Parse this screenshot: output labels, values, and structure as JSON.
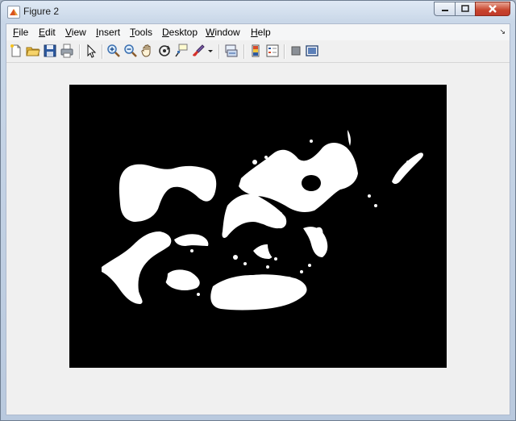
{
  "window": {
    "title": "Figure 2",
    "controls": {
      "minimize": "minimize-icon",
      "maximize": "maximize-icon",
      "close": "close-icon"
    }
  },
  "menubar": {
    "items": [
      {
        "label": "File",
        "underline": "F",
        "rest": "ile"
      },
      {
        "label": "Edit",
        "underline": "E",
        "rest": "dit"
      },
      {
        "label": "View",
        "underline": "V",
        "rest": "iew"
      },
      {
        "label": "Insert",
        "underline": "I",
        "rest": "nsert"
      },
      {
        "label": "Tools",
        "underline": "T",
        "rest": "ools"
      },
      {
        "label": "Desktop",
        "underline": "D",
        "rest": "esktop"
      },
      {
        "label": "Window",
        "underline": "W",
        "rest": "indow"
      },
      {
        "label": "Help",
        "underline": "H",
        "rest": "elp"
      }
    ],
    "dock_icon": "↘"
  },
  "toolbar": {
    "buttons": [
      "new-figure-icon",
      "open-file-icon",
      "save-icon",
      "print-icon",
      "edit-plot-arrow-icon",
      "zoom-in-icon",
      "zoom-out-icon",
      "pan-hand-icon",
      "rotate-3d-icon",
      "data-cursor-icon",
      "brush-icon",
      "brush-dropdown-icon",
      "link-plot-icon",
      "colorbar-icon",
      "legend-icon",
      "hide-plot-tools-icon",
      "show-plot-tools-icon"
    ]
  },
  "figure": {
    "content": "binary-mask-image",
    "colors": {
      "background": "#000000",
      "foreground": "#ffffff"
    }
  }
}
